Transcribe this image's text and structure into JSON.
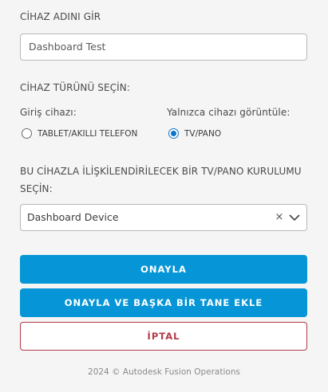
{
  "device_name": {
    "label": "CİHAZ ADINI GİR",
    "value": "Dashboard Test"
  },
  "device_type": {
    "label": "CİHAZ TÜRÜNÜ SEÇİN:",
    "input_group_label": "Giriş cihazı:",
    "display_group_label": "Yalnızca cihazı görüntüle:",
    "options": [
      {
        "label": "TABLET/AKILLI TELEFON",
        "selected": false
      },
      {
        "label": "TV/PANO",
        "selected": true
      }
    ]
  },
  "setup": {
    "label_line1": "BU CİHAZLA İLİŞKİLENDİRİLECEK BİR TV/PANO KURULUMU",
    "label_line2": "SEÇİN:",
    "selected_value": "Dashboard Device",
    "clear_icon": "×"
  },
  "buttons": {
    "confirm": "ONAYLA",
    "confirm_add": "ONAYLA VE BAŞKA BİR TANE EKLE",
    "cancel": "İPTAL"
  },
  "footer": "2024 © Autodesk Fusion Operations",
  "colors": {
    "primary": "#0696d7",
    "radio_selected": "#0a74c9",
    "cancel": "#b23a48"
  }
}
